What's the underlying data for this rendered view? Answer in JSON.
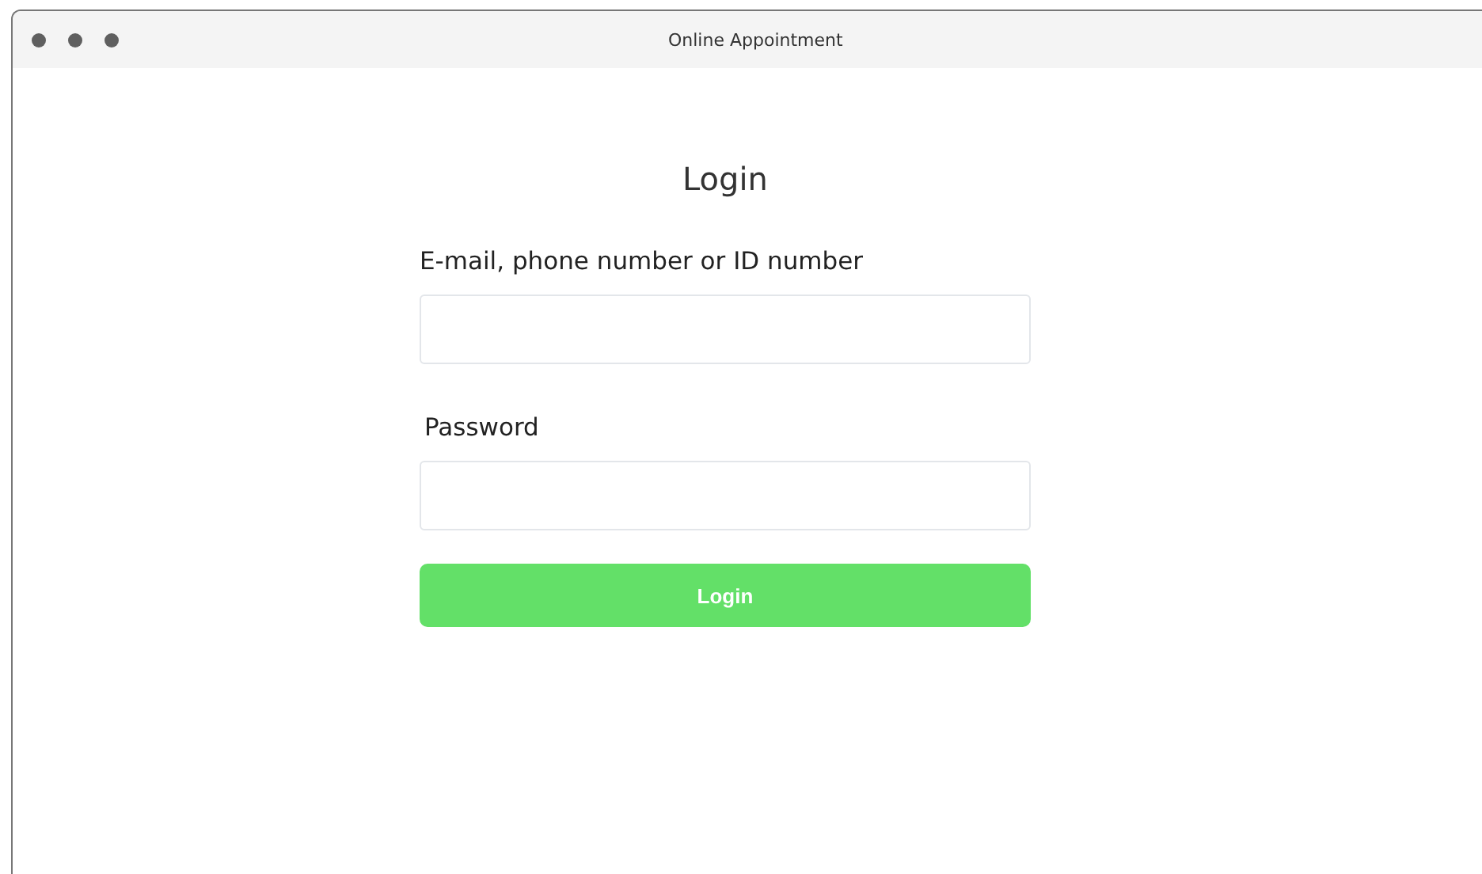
{
  "window": {
    "title": "Online Appointment"
  },
  "form": {
    "title": "Login",
    "fields": [
      {
        "label": "E-mail, phone number or ID number"
      },
      {
        "label": "Password"
      }
    ],
    "button": "Login"
  }
}
